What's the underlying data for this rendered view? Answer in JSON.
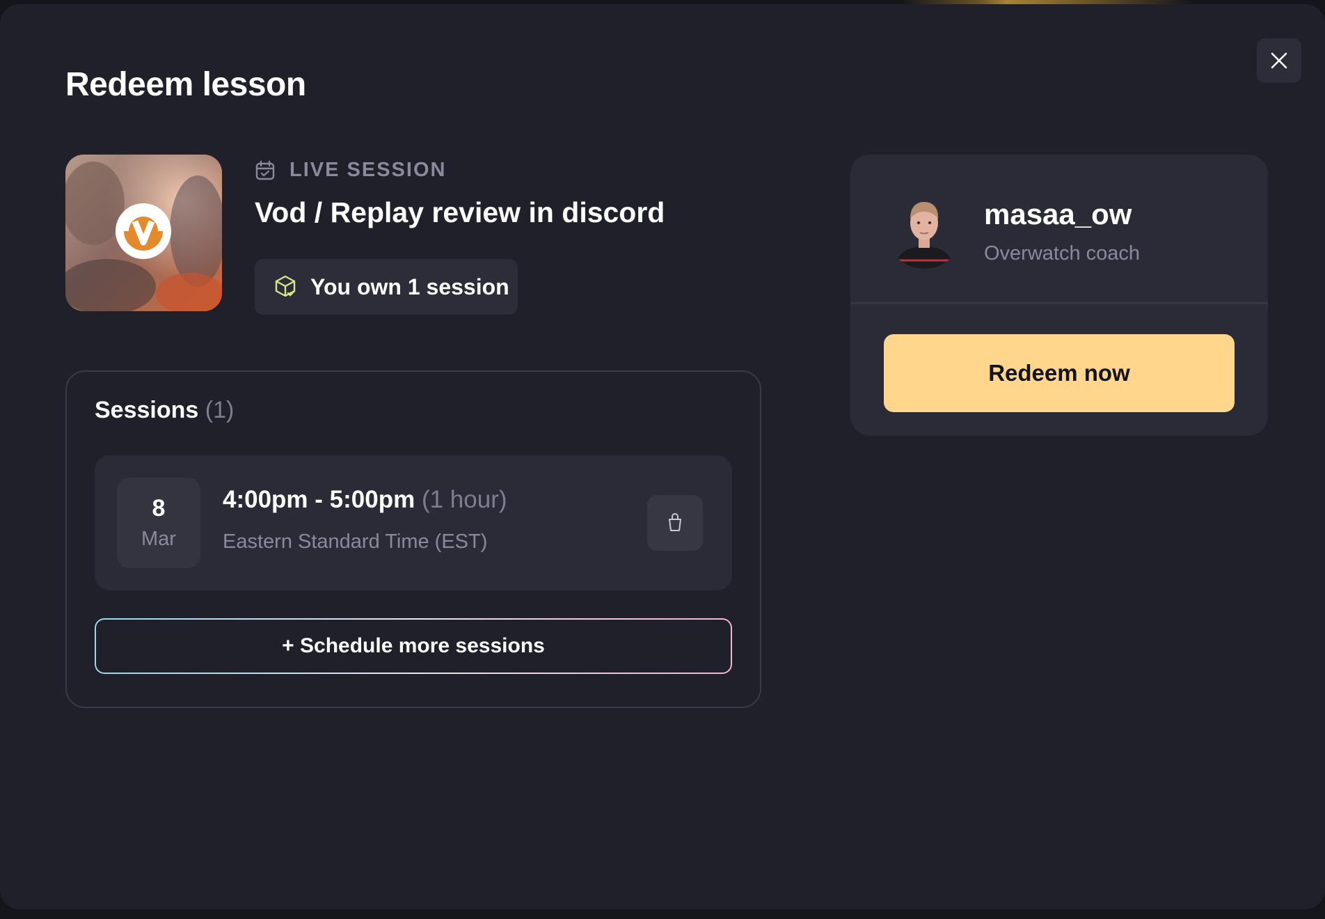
{
  "modal": {
    "title": "Redeem lesson",
    "close_icon": "close-icon"
  },
  "lesson": {
    "type_icon": "calendar-icon",
    "type_label": "LIVE SESSION",
    "name": "Vod / Replay review in discord",
    "thumbnail_icon": "overwatch-logo",
    "ownership": {
      "icon": "package-check-icon",
      "label": "You own 1 session"
    }
  },
  "sessions": {
    "heading": "Sessions",
    "count": "(1)",
    "items": [
      {
        "day": "8",
        "month": "Mar",
        "time_range": "4:00pm - 5:00pm",
        "duration": "(1 hour)",
        "timezone": "Eastern Standard Time (EST)",
        "delete_icon": "trash-icon"
      }
    ],
    "schedule_more_label": "+ Schedule more sessions"
  },
  "coach": {
    "name": "masaa_ow",
    "role": "Overwatch coach",
    "redeem_label": "Redeem now"
  },
  "colors": {
    "background": "#1f2029",
    "card": "#2a2b36",
    "accent_button": "#ffd68c",
    "muted_text": "#8a8a9c",
    "icon_accent": "#d9e58a"
  }
}
